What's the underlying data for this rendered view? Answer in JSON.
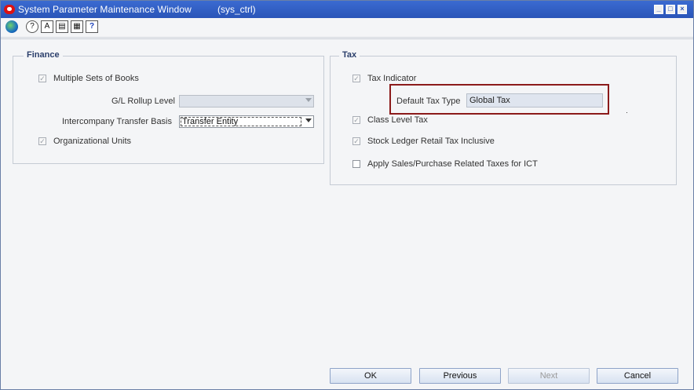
{
  "window": {
    "title": "System Parameter Maintenance Window",
    "module": "(sys_ctrl)",
    "controls": [
      "minimize-icon",
      "maximize-icon",
      "close-icon"
    ]
  },
  "toolbar": {
    "buttons": [
      {
        "name": "globe-icon"
      },
      {
        "name": "world-help-icon"
      },
      {
        "name": "translate-icon",
        "text": "A"
      },
      {
        "name": "clipboard-icon"
      },
      {
        "name": "printer-icon"
      },
      {
        "name": "help-icon",
        "text": "?"
      }
    ]
  },
  "finance": {
    "legend": "Finance",
    "multiple_books": {
      "label": "Multiple Sets of Books",
      "checked": true,
      "enabled": false
    },
    "gl_rollup": {
      "label": "G/L Rollup Level",
      "value": ""
    },
    "intercompany": {
      "label": "Intercompany Transfer Basis",
      "value": "Transfer Entity"
    },
    "org_units": {
      "label": "Organizational Units",
      "checked": true,
      "enabled": false
    }
  },
  "tax": {
    "legend": "Tax",
    "tax_indicator": {
      "label": "Tax Indicator",
      "checked": true,
      "enabled": false
    },
    "default_tax_type": {
      "label": "Default Tax Type",
      "value": "Global Tax"
    },
    "class_level": {
      "label": "Class Level Tax",
      "checked": true,
      "enabled": false
    },
    "stock_ledger": {
      "label": "Stock Ledger Retail Tax Inclusive",
      "checked": true,
      "enabled": false
    },
    "sales_purchase": {
      "label": "Apply Sales/Purchase Related Taxes for ICT",
      "checked": false,
      "enabled": true
    }
  },
  "buttons": {
    "ok": "OK",
    "previous": "Previous",
    "next": "Next",
    "cancel": "Cancel"
  },
  "colors": {
    "titlebar": "#2a55b8",
    "highlight": "#8b1a1a",
    "button_border": "#8ea3c8"
  }
}
